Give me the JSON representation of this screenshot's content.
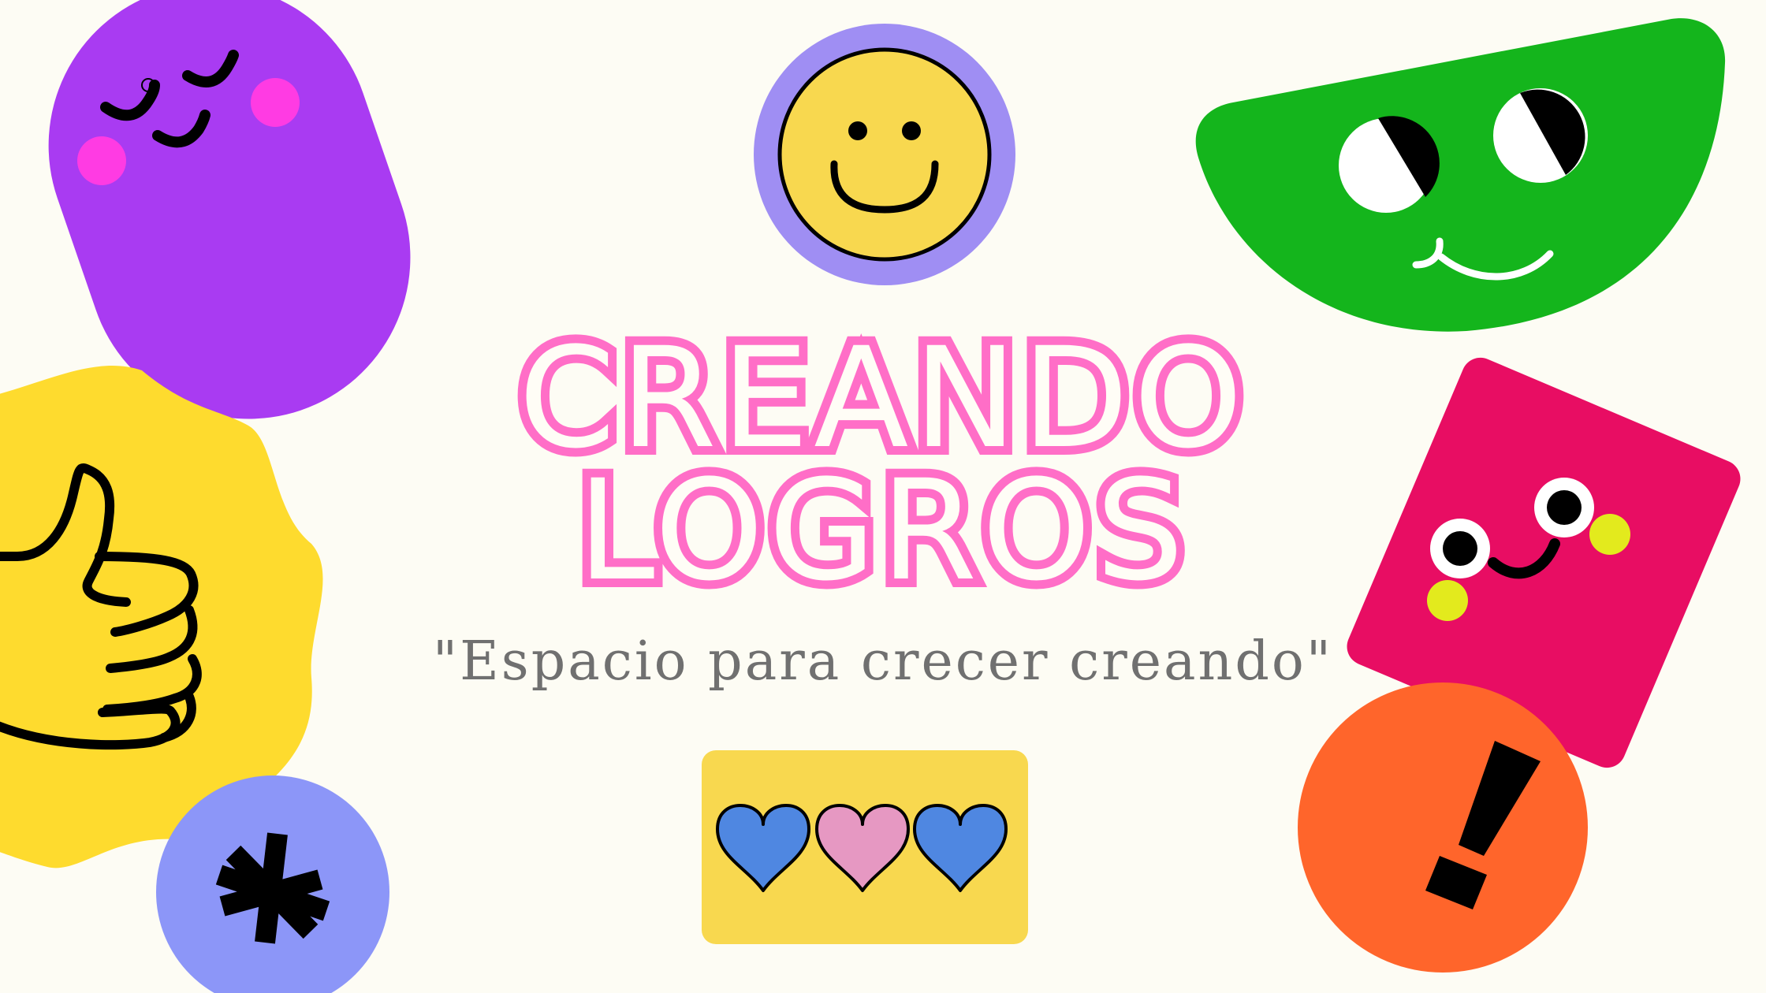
{
  "title": {
    "line1": "CREANDO",
    "line2": "LOGROS"
  },
  "tagline": "\"Espacio para crecer creando\"",
  "hearts": [
    {
      "color": "#4F87E1"
    },
    {
      "color": "#E698C2"
    },
    {
      "color": "#4F87E1"
    }
  ],
  "colors": {
    "background": "#FDFCF4",
    "title": "#FF6EC7",
    "tagline": "#707070",
    "purple": "#A93BF2",
    "yellow": "#FEDB2E",
    "green": "#14B51C",
    "magenta": "#E80D63",
    "orange": "#FF652B",
    "lavender": "#9F8EF3",
    "periwinkle": "#8C96F8",
    "smiley_yellow": "#F8D84F",
    "card_yellow": "#F8D84F"
  },
  "stickers": [
    "purple-sleepy-face",
    "yellow-thumbs-up-badge",
    "asterisk-circle",
    "smiley-face-circle",
    "green-half-moon-face",
    "magenta-square-face",
    "orange-exclamation-circle"
  ]
}
